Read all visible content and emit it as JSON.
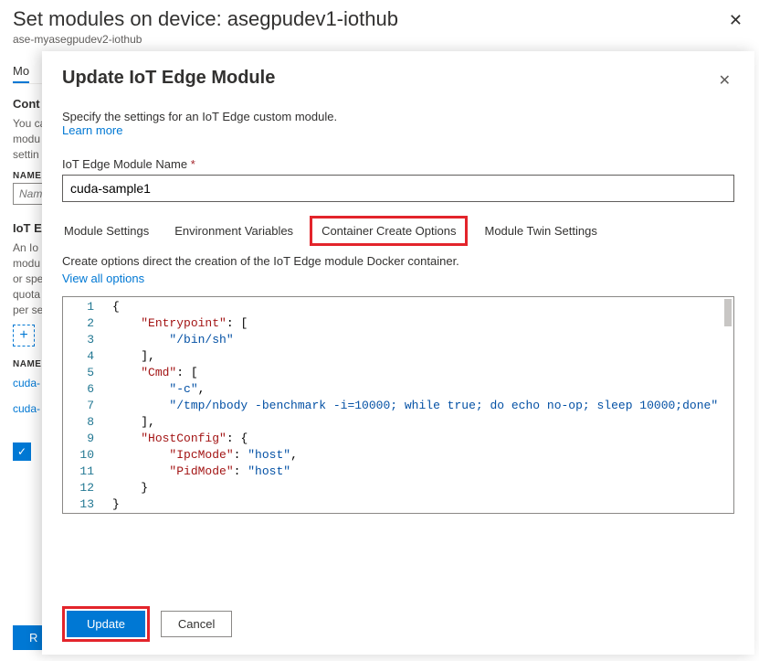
{
  "underlay": {
    "title": "Set modules on device: asegpudev1-iothub",
    "subtitle": "ase-myasegpudev2-iothub",
    "tab": "Mo",
    "section1_title": "Cont",
    "text1": "You ca\nmodu\nsettin",
    "col_name": "NAME",
    "name_input_placeholder": "Nam",
    "section2_title": "IoT E",
    "text2": "An Io\nmodu\nor spe\nquota\nper se",
    "col_name2": "NAME",
    "row1": "cuda-",
    "row2": "cuda-",
    "bottom_btn": "R"
  },
  "panel": {
    "title": "Update IoT Edge Module",
    "description": "Specify the settings for an IoT Edge custom module.",
    "learn_more": "Learn more",
    "field_label": "IoT Edge Module Name",
    "field_required": "*",
    "module_name_value": "cuda-sample1",
    "tabs": {
      "module_settings": "Module Settings",
      "env_vars": "Environment Variables",
      "container_opts": "Container Create Options",
      "twin_settings": "Module Twin Settings"
    },
    "tab_description": "Create options direct the creation of the IoT Edge module Docker container.",
    "view_all": "View all options",
    "buttons": {
      "update": "Update",
      "cancel": "Cancel"
    }
  },
  "code": {
    "line_count": 13,
    "lines": [
      {
        "indent": 0,
        "tokens": [
          {
            "t": "brace",
            "v": "{"
          }
        ]
      },
      {
        "indent": 1,
        "tokens": [
          {
            "t": "key",
            "v": "\"Entrypoint\""
          },
          {
            "t": "punc",
            "v": ": ["
          }
        ]
      },
      {
        "indent": 2,
        "tokens": [
          {
            "t": "str",
            "v": "\"/bin/sh\""
          }
        ]
      },
      {
        "indent": 1,
        "tokens": [
          {
            "t": "punc",
            "v": "],"
          }
        ]
      },
      {
        "indent": 1,
        "tokens": [
          {
            "t": "key",
            "v": "\"Cmd\""
          },
          {
            "t": "punc",
            "v": ": ["
          }
        ]
      },
      {
        "indent": 2,
        "tokens": [
          {
            "t": "str",
            "v": "\"-c\""
          },
          {
            "t": "punc",
            "v": ","
          }
        ]
      },
      {
        "indent": 2,
        "tokens": [
          {
            "t": "str",
            "v": "\"/tmp/nbody -benchmark -i=10000; while true; do echo no-op; sleep 10000;done\""
          }
        ]
      },
      {
        "indent": 1,
        "tokens": [
          {
            "t": "punc",
            "v": "],"
          }
        ]
      },
      {
        "indent": 1,
        "tokens": [
          {
            "t": "key",
            "v": "\"HostConfig\""
          },
          {
            "t": "punc",
            "v": ": {"
          }
        ]
      },
      {
        "indent": 2,
        "tokens": [
          {
            "t": "key",
            "v": "\"IpcMode\""
          },
          {
            "t": "punc",
            "v": ": "
          },
          {
            "t": "str",
            "v": "\"host\""
          },
          {
            "t": "punc",
            "v": ","
          }
        ]
      },
      {
        "indent": 2,
        "tokens": [
          {
            "t": "key",
            "v": "\"PidMode\""
          },
          {
            "t": "punc",
            "v": ": "
          },
          {
            "t": "str",
            "v": "\"host\""
          }
        ]
      },
      {
        "indent": 1,
        "tokens": [
          {
            "t": "punc",
            "v": "}"
          }
        ]
      },
      {
        "indent": 0,
        "tokens": [
          {
            "t": "brace",
            "v": "}"
          }
        ]
      }
    ]
  }
}
